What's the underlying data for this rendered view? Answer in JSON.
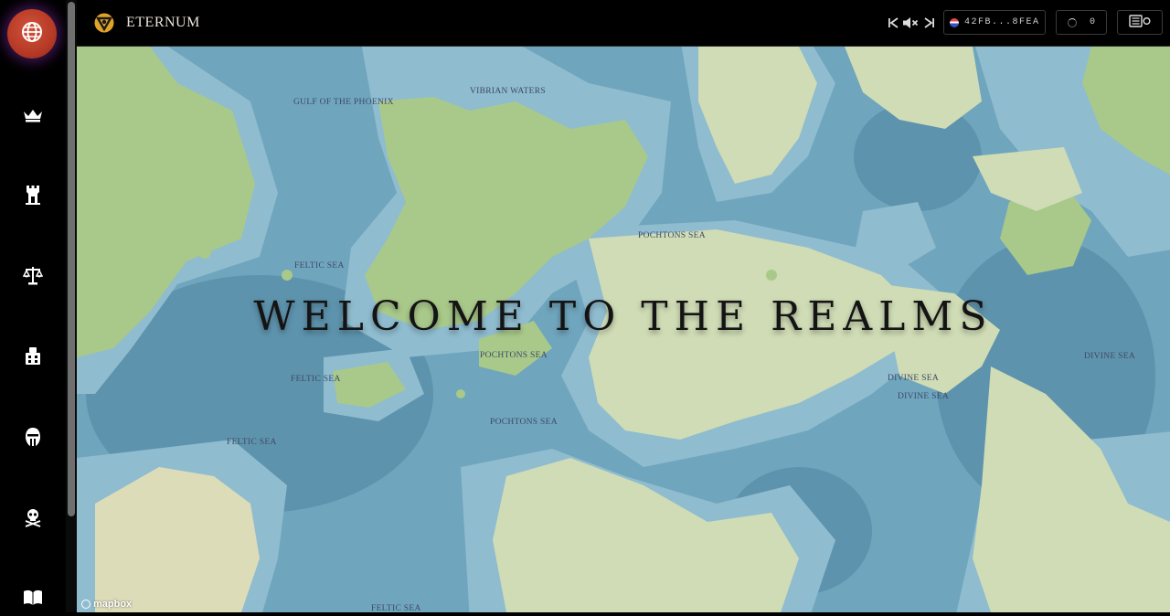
{
  "app": {
    "title": "ETERNUM"
  },
  "header": {
    "wallet_address": "42FB...8FEA",
    "counter_value": "0"
  },
  "sidebar": {
    "items": [
      {
        "icon": "globe-icon",
        "active": true
      },
      {
        "icon": "crown-icon"
      },
      {
        "icon": "castle-icon"
      },
      {
        "icon": "scales-icon"
      },
      {
        "icon": "army-icon"
      },
      {
        "icon": "helmet-icon"
      },
      {
        "icon": "skull-crossbones-icon"
      },
      {
        "icon": "book-icon"
      }
    ]
  },
  "map": {
    "headline": "WELCOME TO THE REALMS",
    "attribution": "mapbox",
    "labels": {
      "gulf_phoenix": "GULF OF THE PHOENIX",
      "vibrian_waters": "VIBRIAN WATERS",
      "pochtons_sea_1": "POCHTONS SEA",
      "feltic_sea_1": "FELTIC SEA",
      "pochtons_sea_2": "POCHTONS SEA",
      "feltic_sea_2": "FELTIC SEA",
      "pochtons_sea_3": "POCHTONS SEA",
      "feltic_sea_3": "FELTIC SEA",
      "divine_sea_1": "DIVINE SEA",
      "divine_sea_2": "DIVINE SEA",
      "divine_sea_3": "DIVINE SEA",
      "feltic_sea_4": "FELTIC SEA"
    }
  },
  "colors": {
    "sea": "#6fa5bd",
    "sea_deep": "#5e93ad",
    "shelf": "#8fbccf",
    "land_green": "#a9c98a",
    "land_pale": "#cfdcb5",
    "land_sand": "#dcdcb8",
    "accent_globe": "#c0402b"
  }
}
